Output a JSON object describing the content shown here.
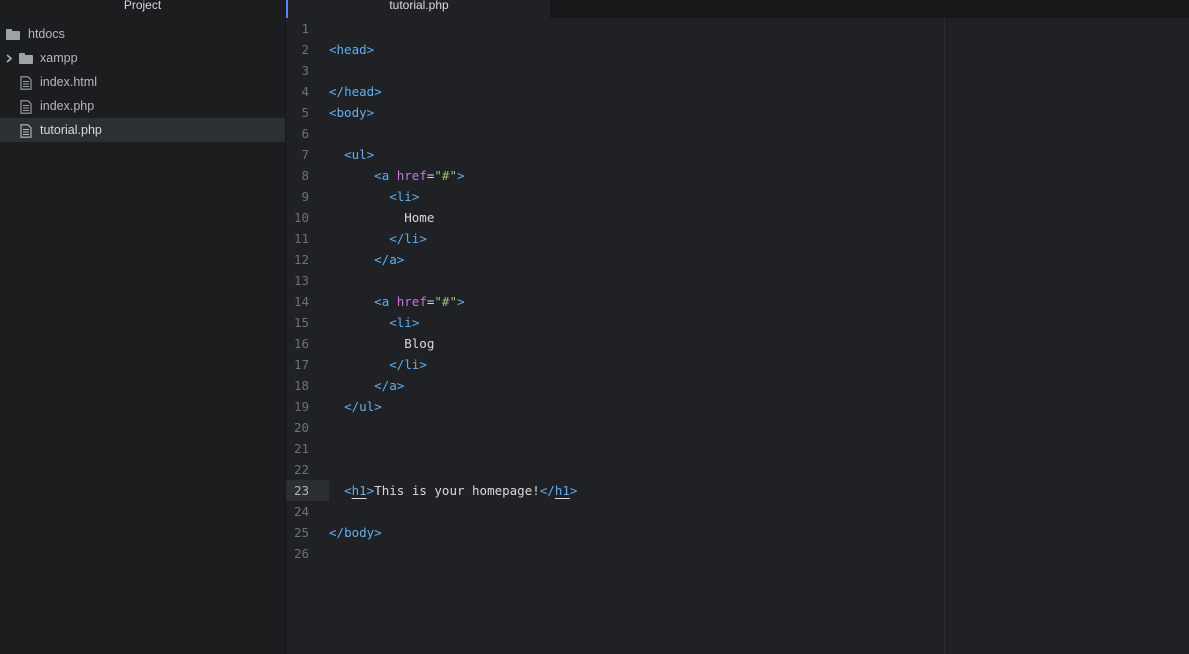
{
  "sidebar": {
    "title": "Project",
    "items": [
      {
        "label": "htdocs",
        "icon": "folder-icon",
        "depth": 0,
        "expanded": true
      },
      {
        "label": "xampp",
        "icon": "folder-icon",
        "depth": 1,
        "collapsed": true
      },
      {
        "label": "index.html",
        "icon": "file-text-icon",
        "depth": 1
      },
      {
        "label": "index.php",
        "icon": "file-text-icon",
        "depth": 1
      },
      {
        "label": "tutorial.php",
        "icon": "file-text-icon",
        "depth": 1,
        "selected": true
      }
    ]
  },
  "tabs": [
    {
      "label": "tutorial.php",
      "active": true
    }
  ],
  "editor": {
    "active_line": 23,
    "line_numbers": [
      "1",
      "2",
      "3",
      "4",
      "5",
      "6",
      "7",
      "8",
      "9",
      "10",
      "11",
      "12",
      "13",
      "14",
      "15",
      "16",
      "17",
      "18",
      "19",
      "20",
      "21",
      "22",
      "23",
      "24",
      "25",
      "26"
    ],
    "lines": [
      "",
      "<head>",
      "",
      "</head>",
      "<body>",
      "",
      "  <ul>",
      "      <a href=\"#\">",
      "        <li>",
      "          Home",
      "        </li>",
      "      </a>",
      "",
      "      <a href=\"#\">",
      "        <li>",
      "          Blog",
      "        </li>",
      "      </a>",
      "  </ul>",
      "",
      "",
      "",
      "  <h1>This is your homepage!</h1>",
      "",
      "</body>",
      ""
    ]
  },
  "colors": {
    "tag": "#61afef",
    "attribute": "#c678dd",
    "string": "#98c379",
    "text": "#d7dae0",
    "accent": "#528bff"
  }
}
